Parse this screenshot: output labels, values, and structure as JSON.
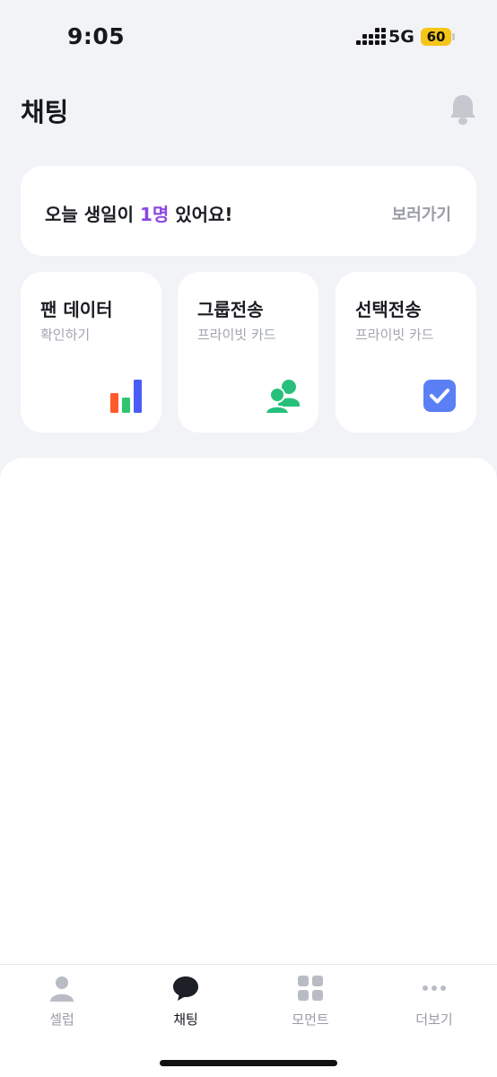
{
  "status_bar": {
    "time": "9:05",
    "network": "5G",
    "battery": "60"
  },
  "header": {
    "title": "채팅",
    "bell_icon": "bell-icon"
  },
  "birthday": {
    "prefix": "오늘 생일이 ",
    "count": "1명",
    "suffix": " 있어요!",
    "link": "보러가기"
  },
  "cards": [
    {
      "title": "팬 데이터",
      "subtitle": "확인하기",
      "icon": "bar-chart-icon"
    },
    {
      "title": "그룹전송",
      "subtitle": "프라이빗 카드",
      "icon": "group-users-icon"
    },
    {
      "title": "선택전송",
      "subtitle": "프라이빗 카드",
      "icon": "checkbox-icon"
    }
  ],
  "tabs": [
    {
      "label": "셀럽",
      "icon": "person-icon"
    },
    {
      "label": "채팅",
      "icon": "chat-bubble-icon",
      "active": true
    },
    {
      "label": "모먼트",
      "icon": "grid-icon"
    },
    {
      "label": "더보기",
      "icon": "more-dots-icon"
    }
  ],
  "colors": {
    "accent_purple": "#8a48e0",
    "bar_orange": "#ff5a2a",
    "bar_green": "#2fc66f",
    "bar_blue": "#4a5cf6",
    "group_green": "#27c07a",
    "check_blue": "#5b80f5"
  }
}
